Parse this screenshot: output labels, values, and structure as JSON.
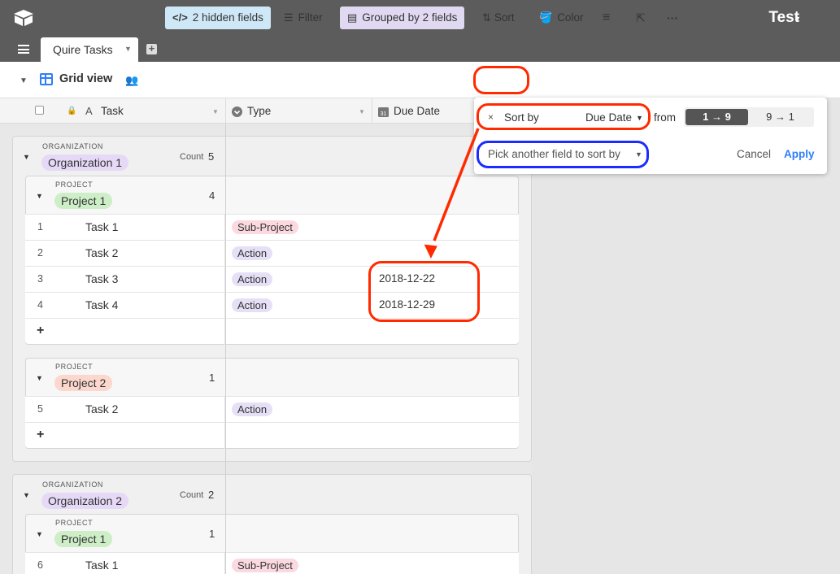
{
  "app": {
    "base_name": "Test"
  },
  "tabs": [
    {
      "label": "Quire Tasks"
    }
  ],
  "toolbar": {
    "view_name": "Grid view",
    "hidden_fields": "2 hidden fields",
    "filter": "Filter",
    "grouped": "Grouped by 2 fields",
    "sort": "Sort",
    "color": "Color"
  },
  "columns": [
    {
      "label": "Task"
    },
    {
      "label": "Type"
    },
    {
      "label": "Due Date"
    }
  ],
  "groups": [
    {
      "level_label": "ORGANIZATION",
      "name": "Organization 1",
      "count_label": "Count",
      "count": "5",
      "projects": [
        {
          "level_label": "PROJECT",
          "name": "Project 1",
          "count": "4",
          "rows": [
            {
              "num": "1",
              "task": "Task 1",
              "type": "Sub-Project",
              "due": ""
            },
            {
              "num": "2",
              "task": "Task 2",
              "type": "Action",
              "due": ""
            },
            {
              "num": "3",
              "task": "Task 3",
              "type": "Action",
              "due": "2018-12-22"
            },
            {
              "num": "4",
              "task": "Task 4",
              "type": "Action",
              "due": "2018-12-29"
            }
          ]
        },
        {
          "level_label": "PROJECT",
          "name": "Project 2",
          "count": "1",
          "rows": [
            {
              "num": "5",
              "task": "Task 2",
              "type": "Action",
              "due": ""
            }
          ]
        }
      ]
    },
    {
      "level_label": "ORGANIZATION",
      "name": "Organization 2",
      "count_label": "Count",
      "count": "2",
      "projects": [
        {
          "level_label": "PROJECT",
          "name": "Project 1",
          "count": "1",
          "rows": [
            {
              "num": "6",
              "task": "Task 1",
              "type": "Sub-Project",
              "due": ""
            }
          ]
        }
      ]
    }
  ],
  "add_row_symbol": "+",
  "sort_popover": {
    "close_symbol": "×",
    "sort_by_label": "Sort by",
    "field": "Due Date",
    "from_label": "from",
    "asc_label": "1 → 9",
    "desc_label": "9 → 1",
    "pick_another": "Pick another field to sort by",
    "cancel": "Cancel",
    "apply": "Apply"
  },
  "colors": {
    "topbar": "#5c5c5c",
    "accent_blue": "#2d7ff9",
    "annotation_red": "#ff2a00",
    "annotation_blue": "#1a2cff"
  }
}
